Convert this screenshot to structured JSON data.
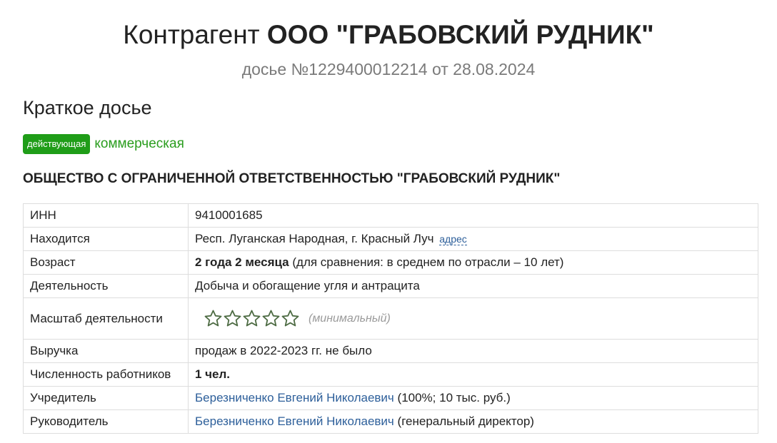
{
  "header": {
    "title_prefix": "Контрагент",
    "title_name": "ООО \"ГРАБОВСКИЙ РУДНИК\"",
    "subtitle": "досье №1229400012214 от 28.08.2024"
  },
  "section": {
    "heading": "Краткое досье",
    "status_badge": "действующая",
    "type_label": "коммерческая",
    "full_name": "ОБЩЕСТВО С ОГРАНИЧЕННОЙ ОТВЕТСТВЕННОСТЬЮ \"ГРАБОВСКИЙ РУДНИК\""
  },
  "rows": {
    "inn": {
      "label": "ИНН",
      "value": "9410001685"
    },
    "location": {
      "label": "Находится",
      "value": "Респ. Луганская Народная, г. Красный Луч",
      "link": "адрес"
    },
    "age": {
      "label": "Возраст",
      "value_bold": "2 года 2 месяца",
      "value_rest": "(для сравнения: в среднем по отрасли – 10 лет)"
    },
    "activity": {
      "label": "Деятельность",
      "value": "Добыча и обогащение угля и антрацита"
    },
    "scale": {
      "label": "Масштаб деятельности",
      "rating": 0,
      "rating_max": 5,
      "note": "(минимальный)"
    },
    "revenue": {
      "label": "Выручка",
      "value": "продаж в 2022-2023 гг. не было"
    },
    "employees": {
      "label": "Численность работников",
      "value": "1 чел."
    },
    "founder": {
      "label": "Учредитель",
      "name": "Березниченко Евгений Николаевич",
      "detail": "(100%; 10 тыс. руб.)"
    },
    "director": {
      "label": "Руководитель",
      "name": "Березниченко Евгений Николаевич",
      "detail": "(генеральный директор)"
    }
  },
  "colors": {
    "badge_bg": "#1f9d18",
    "type_text": "#2a9d1e",
    "link": "#2d5f9a",
    "star_outline": "#4d6b43"
  }
}
